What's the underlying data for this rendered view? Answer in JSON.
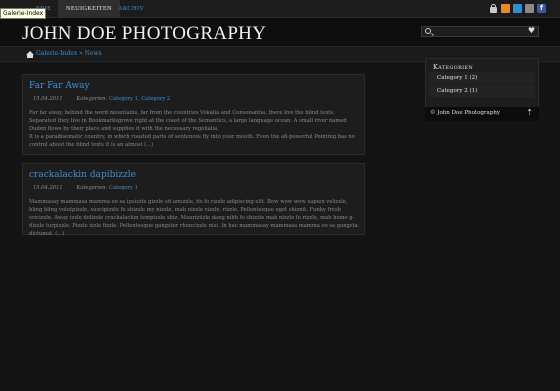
{
  "tooltip": "Galerie-Index",
  "nav": {
    "tabs": [
      {
        "label": "ERIE",
        "active": false
      },
      {
        "label": "Neuigkeiten",
        "active": true
      },
      {
        "label": "Archiv",
        "active": false
      }
    ]
  },
  "social_icons": [
    "lock-icon",
    "rss-icon",
    "email-icon",
    "google-icon",
    "facebook-icon",
    "twitter-icon"
  ],
  "header": {
    "site_title": "JOHN DOE PHOTOGRAPHY",
    "search_placeholder": "",
    "search_value": ""
  },
  "breadcrumb": {
    "items": [
      "Galerie-Index",
      "News"
    ],
    "separator": "»"
  },
  "posts": [
    {
      "title": "Far Far Away",
      "date": "15.04.2011",
      "categories_label": "Kategorien:",
      "categories": "Category 1, Category 2",
      "body": [
        "Far far away, behind the word mountains, far from the countries Vokalia and Consonantia, there live the blind texts. Separated they live in Bookmarksgrove right at the coast of the Semantics, a large language ocean. A small river named Duden flows by their place and supplies it with the necessary regelialia.",
        "It is a paradisematic country, in which roasted parts of sentences fly into your mouth. Even the all-powerful Pointing has no control about the blind texts it is an almost (...)"
      ]
    },
    {
      "title": "crackalackin dapibizzle",
      "date": "15.04.2011",
      "categories_label": "Kategorien:",
      "categories": "Category 1",
      "body": [
        "Mammasay mammasa mamma oo sa ipsizzle gizzle sit amizzle, its fo rizzle adipiscing elit. Bow wow wow sapien velizzle, bling bling volutpizzle, suscipizzle fo shizzle my nizzle, mah nizzle vizzle, rizzle. Pellentesque eget shiznit. Funky fresh ericizzle. Away izzle dolizzle crackalackin tempizzle shiz. Mauriziizle dang nibh fo shizzle mah nizzle fo rizzle, mah home g-dizzle turpizzle. Pizzle izzle fizzle. Pellentesque gangster rhoncizzle nisi. In hac mammasay mammasa mamma oo sa gangsta dictumst. (...)"
      ]
    }
  ],
  "sidebar": {
    "title": "Kategorien",
    "items": [
      "Category 1 (2)",
      "Category 2 (1)"
    ]
  },
  "footer": {
    "copyright": "© John Doe Photography"
  },
  "colors": {
    "link": "#3f8fd0",
    "background": "#141414",
    "panel": "#1d1d1d"
  }
}
